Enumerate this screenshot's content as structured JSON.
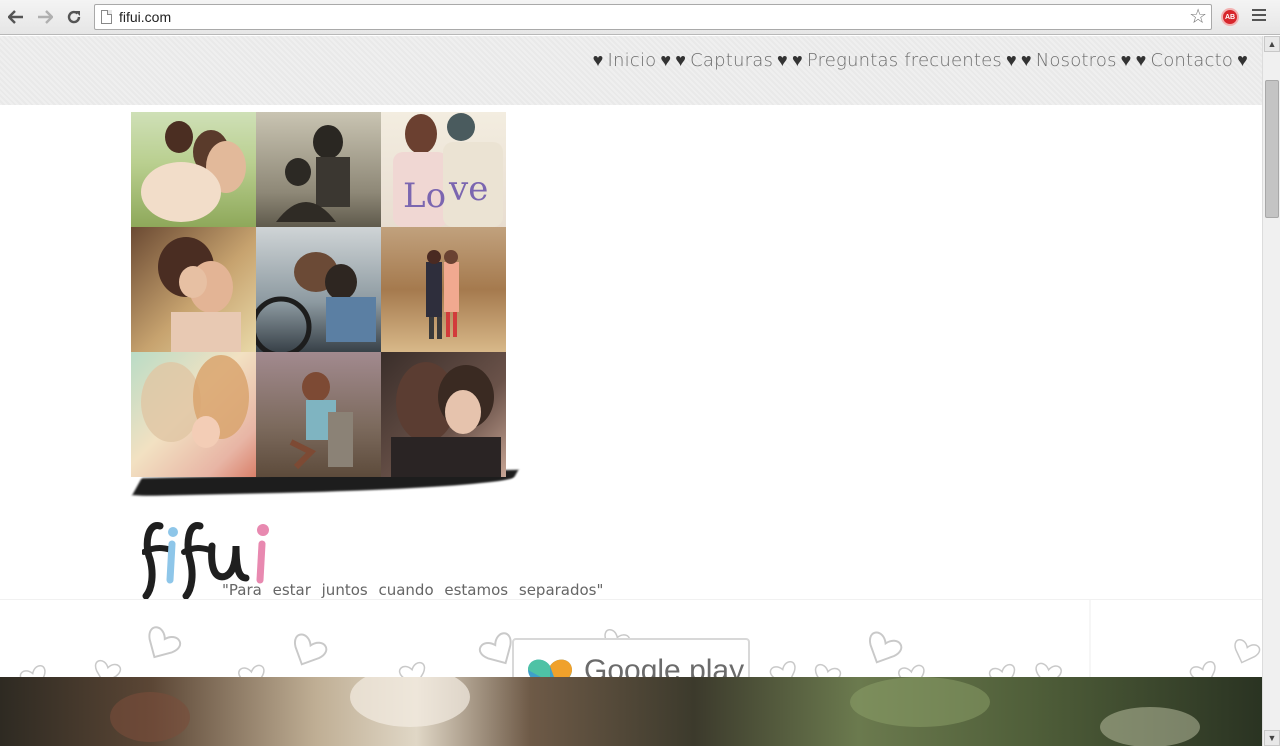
{
  "browser": {
    "url": "fifui.com",
    "back_icon": "back-arrow-icon",
    "forward_icon": "forward-arrow-icon",
    "reload_icon": "reload-icon",
    "bookmark_icon": "star-icon",
    "extension_badge": "AB"
  },
  "header": {
    "menu": [
      {
        "label": "Inicio"
      },
      {
        "label": "Capturas"
      },
      {
        "label": "Preguntas frecuentes"
      },
      {
        "label": "Nosotros"
      },
      {
        "label": "Contacto"
      }
    ],
    "heart": "♥"
  },
  "brand": {
    "logo": "fifui",
    "tagline": "\"Para estar juntos cuando estamos separados\""
  },
  "store_badge": {
    "label": "Google play"
  },
  "colors": {
    "logo_dark": "#1f1f1f",
    "logo_blue": "#8ec6e9",
    "logo_pink": "#e889b0",
    "menu_text": "#6b6b6b",
    "hearts": "#c9c9c9"
  },
  "collage": {
    "photos": [
      {
        "subject": "couple-on-grass"
      },
      {
        "subject": "vintage-couple"
      },
      {
        "subject": "love-sweaters"
      },
      {
        "subject": "couple-embrace"
      },
      {
        "subject": "couple-in-car"
      },
      {
        "subject": "couple-walking-autumn"
      },
      {
        "subject": "couple-soft-light"
      },
      {
        "subject": "couple-lift-forest"
      },
      {
        "subject": "couple-kiss-cheek"
      }
    ]
  }
}
